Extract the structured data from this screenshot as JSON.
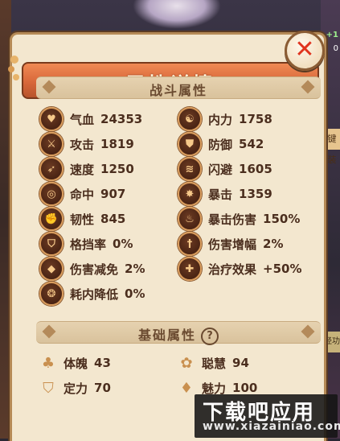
{
  "panel": {
    "title": "属性详情"
  },
  "combat": {
    "header": "战斗属性",
    "left": [
      {
        "name": "气血",
        "value": "24353",
        "icon": "heart-icon"
      },
      {
        "name": "攻击",
        "value": "1819",
        "icon": "sword-icon"
      },
      {
        "name": "速度",
        "value": "1250",
        "icon": "boot-icon"
      },
      {
        "name": "命中",
        "value": "907",
        "icon": "target-icon"
      },
      {
        "name": "韧性",
        "value": "845",
        "icon": "fist-icon"
      },
      {
        "name": "格挡率",
        "value": "0%",
        "icon": "block-icon"
      },
      {
        "name": "伤害减免",
        "value": "2%",
        "icon": "damage-reduction-icon"
      },
      {
        "name": "耗内降低",
        "value": "0%",
        "icon": "energy-icon"
      }
    ],
    "right": [
      {
        "name": "内力",
        "value": "1758",
        "icon": "yinyang-icon"
      },
      {
        "name": "防御",
        "value": "542",
        "icon": "armor-icon"
      },
      {
        "name": "闪避",
        "value": "1605",
        "icon": "dodge-icon"
      },
      {
        "name": "暴击",
        "value": "1359",
        "icon": "crit-icon"
      },
      {
        "name": "暴击伤害",
        "value": "150%",
        "icon": "flame-icon"
      },
      {
        "name": "伤害增幅",
        "value": "2%",
        "icon": "dagger-icon"
      },
      {
        "name": "治疗效果",
        "value": "+50%",
        "icon": "cross-icon"
      }
    ]
  },
  "basic": {
    "header": "基础属性",
    "help": "?",
    "left": [
      {
        "name": "体魄",
        "value": "43",
        "icon": "muscle-icon"
      },
      {
        "name": "定力",
        "value": "70",
        "icon": "shield-icon"
      }
    ],
    "right": [
      {
        "name": "聪慧",
        "value": "94",
        "icon": "lotus-icon"
      },
      {
        "name": "魅力",
        "value": "100",
        "icon": "drop-icon"
      }
    ]
  },
  "side": {
    "num_top": "+1",
    "num_second": "0",
    "tag_right": "键装",
    "tag_right2": "经功"
  },
  "watermark": {
    "main": "下载吧应用",
    "sub": "www.xiazainiao.com"
  },
  "icons": {
    "close": "close-icon"
  }
}
